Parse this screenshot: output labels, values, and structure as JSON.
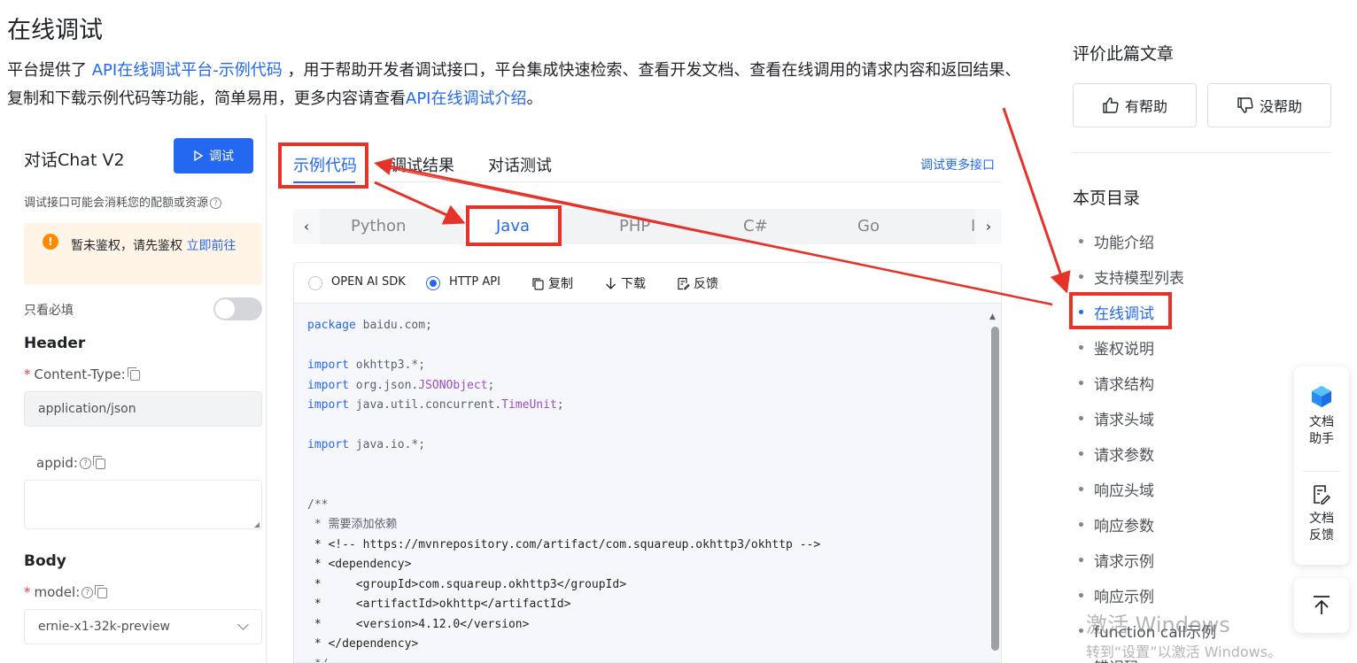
{
  "page": {
    "title": "在线调试",
    "intro_pre": "平台提供了 ",
    "intro_link1": "API在线调试平台-示例代码",
    "intro_mid": " ，用于帮助开发者调试接口，平台集成快速检索、查看开发文档、查看在线调用的请求内容和返回结果、复制和下载示例代码等功能，简单易用，更多内容请查看",
    "intro_link2": "API在线调试介绍",
    "intro_post": "。"
  },
  "debug_panel": {
    "title": "对话Chat V2",
    "debug_button": "调试",
    "note": "调试接口可能会消耗您的配额或资源",
    "warning_text": "暂未鉴权，请先鉴权 ",
    "warning_link": "立即前往",
    "required_only_label": "只看必填",
    "header_section": "Header",
    "content_type_label": "Content-Type:",
    "content_type_value": "application/json",
    "appid_label": "appid:",
    "body_section": "Body",
    "model_label": "model:",
    "model_value": "ernie-x1-32k-preview"
  },
  "tabs": {
    "items": [
      "示例代码",
      "调试结果",
      "对话测试"
    ],
    "more_link": "调试更多接口"
  },
  "languages": {
    "items": [
      "Python",
      "Java",
      "PHP",
      "C#",
      "Go",
      "I"
    ],
    "selected": "Java"
  },
  "code_toolbar": {
    "sdk_option": "OPEN AI SDK",
    "http_option": "HTTP API",
    "copy": "复制",
    "download": "下载",
    "feedback": "反馈"
  },
  "code": {
    "l1_pkg": "package",
    "l1_rest": " baidu.com;",
    "l3_imp": "import",
    "l3_rest": " okhttp3.*;",
    "l4_imp": "import",
    "l4_pre": " org.json.",
    "l4_type": "JSONObject",
    "l4_post": ";",
    "l5_imp": "import",
    "l5_pre": " java.util.concurrent.",
    "l5_type": "TimeUnit",
    "l5_post": ";",
    "l7_imp": "import",
    "l7_rest": " java.io.*;",
    "l10": "/**",
    "l11": " * 需要添加依赖",
    "l12": " * <!-- https://mvnrepository.com/artifact/com.squareup.okhttp3/okhttp -->",
    "l13": " * <dependency>",
    "l14": " *     <groupId>com.squareup.okhttp3</groupId>",
    "l15": " *     <artifactId>okhttp</artifactId>",
    "l16": " *     <version>4.12.0</version>",
    "l17": " * </dependency>",
    "l18": " */"
  },
  "sidebar": {
    "rate_title": "评价此篇文章",
    "helpful": "有帮助",
    "not_helpful": "没帮助",
    "toc_title": "本页目录",
    "toc": [
      "功能介绍",
      "支持模型列表",
      "在线调试",
      "鉴权说明",
      "请求结构",
      "请求头域",
      "请求参数",
      "响应头域",
      "响应参数",
      "请求示例",
      "响应示例",
      "function call示例",
      "错误码"
    ],
    "toc_active": "在线调试"
  },
  "float_tools": {
    "assistant": "文档助手",
    "feedback": "文档反馈"
  },
  "watermark": {
    "line1": "激活 Windows",
    "line2": "转到“设置”以激活 Windows。"
  },
  "colors": {
    "accent": "#2468f2",
    "annotation_red": "#e5332a",
    "warning": "#ff8a00"
  }
}
